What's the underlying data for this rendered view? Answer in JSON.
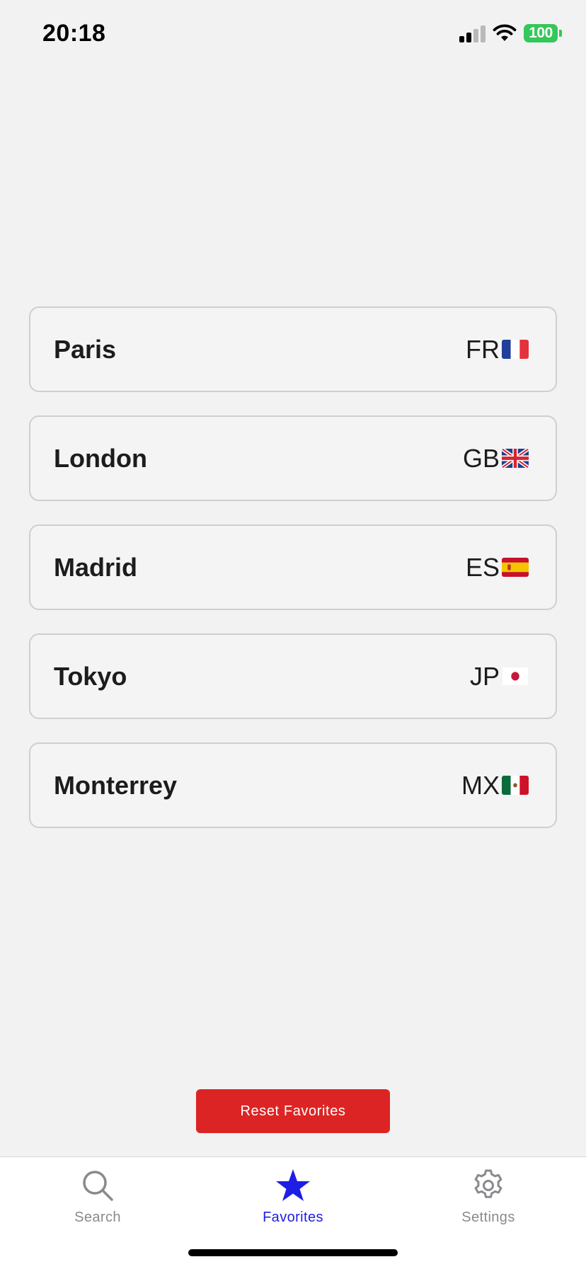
{
  "status_bar": {
    "time": "20:18",
    "battery": "100",
    "icons": [
      "signal-icon",
      "wifi-icon",
      "battery-icon"
    ]
  },
  "cities": [
    {
      "name": "Paris",
      "code": "FR",
      "flag_icon": "france-flag-icon"
    },
    {
      "name": "London",
      "code": "GB",
      "flag_icon": "uk-flag-icon"
    },
    {
      "name": "Madrid",
      "code": "ES",
      "flag_icon": "spain-flag-icon"
    },
    {
      "name": "Tokyo",
      "code": "JP",
      "flag_icon": "japan-flag-icon"
    },
    {
      "name": "Monterrey",
      "code": "MX",
      "flag_icon": "mexico-flag-icon"
    }
  ],
  "reset_button": {
    "label": "Reset Favorites",
    "color": "#dd2424"
  },
  "tab_bar": {
    "tabs": [
      {
        "label": "Search",
        "icon": "search-icon",
        "active": false
      },
      {
        "label": "Favorites",
        "icon": "star-icon",
        "active": true
      },
      {
        "label": "Settings",
        "icon": "gear-icon",
        "active": false
      }
    ],
    "active_color": "#1e1ee6",
    "inactive_color": "#8a8a8e"
  }
}
